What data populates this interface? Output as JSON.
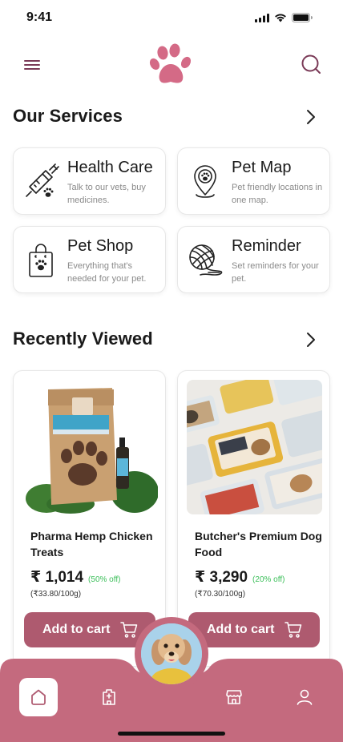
{
  "status_bar": {
    "time": "9:41"
  },
  "header": {
    "menu_icon": "hamburger-menu-icon",
    "logo_icon": "paw-logo-icon",
    "search_icon": "search-icon"
  },
  "colors": {
    "brand": "#ae5a6f",
    "nav_bg": "#c46a7e",
    "discount_green": "#3cbf5a",
    "muted_text": "#8a8a8a"
  },
  "services": {
    "title": "Our Services",
    "items": [
      {
        "title": "Health Care",
        "desc": "Talk to our vets, buy medicines.",
        "icon": "syringe-paw-icon"
      },
      {
        "title": "Pet Map",
        "desc": "Pet friendly locations in one map.",
        "icon": "map-pin-paw-icon"
      },
      {
        "title": "Pet Shop",
        "desc": "Everything that's needed for your pet.",
        "icon": "shopping-bag-paw-icon"
      },
      {
        "title": "Reminder",
        "desc": "Set reminders for your pet.",
        "icon": "yarn-ball-icon"
      }
    ]
  },
  "recent": {
    "title": "Recently Viewed",
    "items": [
      {
        "name": "Pharma Hemp Chicken Treats",
        "price": "₹ 1,014",
        "discount": "(50% off)",
        "unit_price": "(₹33.80/100g)",
        "cart_label": "Add to cart"
      },
      {
        "name": "Butcher's Premium Dog Food",
        "price": "₹ 3,290",
        "discount": "(20% off)",
        "unit_price": "(₹70.30/100g)",
        "cart_label": "Add to cart"
      }
    ]
  },
  "bottom_nav": {
    "items": [
      {
        "icon": "home-icon",
        "active": true
      },
      {
        "icon": "hospital-icon",
        "active": false
      },
      {
        "icon": "store-icon",
        "active": false
      },
      {
        "icon": "profile-icon",
        "active": false
      }
    ],
    "avatar": "dog-avatar"
  }
}
